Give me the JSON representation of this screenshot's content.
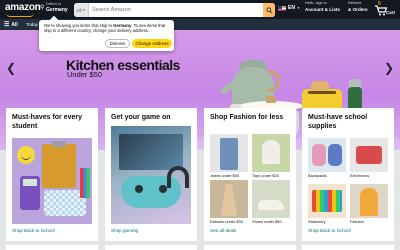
{
  "header": {
    "logo_text": "amazon",
    "deliver_line1": "Deliver to",
    "deliver_line2": "Germany",
    "search": {
      "category": "All",
      "placeholder": "Search Amazon"
    },
    "language": "EN",
    "account_line1": "Hello, sign in",
    "account_line2": "Account & Lists",
    "orders_line1": "Returns",
    "orders_line2": "& Orders",
    "cart_count": "0",
    "cart_label": "Cart"
  },
  "subnav": {
    "all_label": "All",
    "today_label": "Today"
  },
  "popover": {
    "message_pre": "We're showing you items that ship to ",
    "country": "Germany",
    "message_post": ". To see items that ship to a different country, change your delivery address.",
    "dismiss_label": "Dismiss",
    "change_label": "Change Address"
  },
  "hero": {
    "title": "Kitchen essentials",
    "subtitle": "Under $50"
  },
  "cards": [
    {
      "title": "Must-haves for every student",
      "link": "Shop Back to School"
    },
    {
      "title": "Get your game on",
      "link": "Shop gaming"
    },
    {
      "title": "Shop Fashion for less",
      "link": "See all deals",
      "tiles": [
        "Jeans under $50",
        "Tops under $25",
        "Dresses under $30",
        "Shoes under $50"
      ]
    },
    {
      "title": "Must-have school supplies",
      "link": "Shop Back to School",
      "tiles": [
        "Backpacks",
        "Electronics",
        "Stationery",
        "Fashion"
      ]
    }
  ],
  "colors": {
    "nav_bg": "#131921",
    "subnav_bg": "#232f3e",
    "search_button": "#febd69",
    "brand_accent": "#ff9900",
    "link": "#007185",
    "primary_button": "#ffd814"
  },
  "icons": [
    "location-pin-icon",
    "search-icon",
    "us-flag-icon",
    "chevron-down-icon",
    "cart-icon",
    "hamburger-icon",
    "chevron-left-icon",
    "chevron-right-icon"
  ]
}
